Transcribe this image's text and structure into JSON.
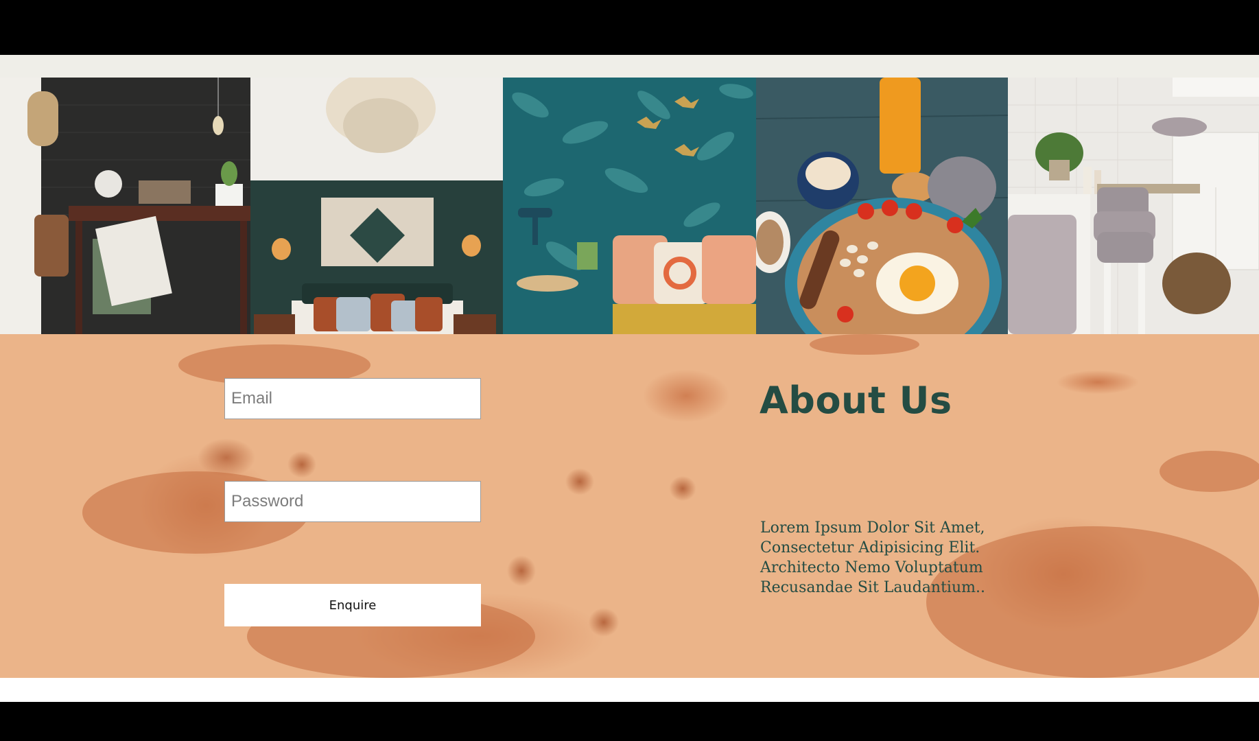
{
  "gallery": {
    "images": [
      {
        "name": "workspace-desk-photo"
      },
      {
        "name": "bedroom-photo"
      },
      {
        "name": "teal-wallpaper-lounge-photo"
      },
      {
        "name": "breakfast-photo"
      },
      {
        "name": "bathroom-photo"
      }
    ]
  },
  "form": {
    "email_placeholder": "Email",
    "password_placeholder": "Password",
    "submit_label": "Enquire"
  },
  "about": {
    "title": "About Us",
    "body": "Lorem Ipsum Dolor Sit Amet, Consectetur Adipisicing Elit. Architecto Nemo Voluptatum Recusandae Sit Laudantium.."
  },
  "colors": {
    "heading": "#244c43",
    "background_terracotta": "#ebb489",
    "top_strip": "#efeee8"
  }
}
